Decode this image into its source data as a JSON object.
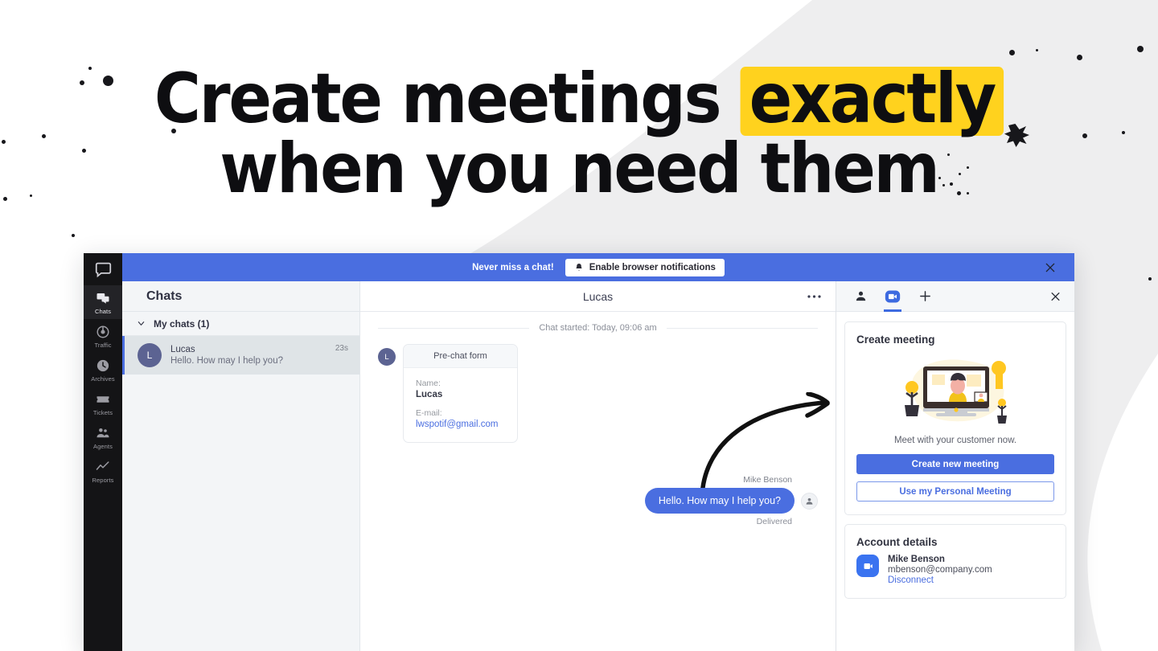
{
  "hero": {
    "line1_pre": "Create meetings ",
    "line1_mark": "exactly",
    "line2": "when you need them",
    "highlight_color": "#ffd21e"
  },
  "app": {
    "rail": {
      "logo_icon": "livechat-logo-icon",
      "items": [
        {
          "label": "Chats",
          "icon": "chats-icon",
          "active": true
        },
        {
          "label": "Traffic",
          "icon": "traffic-icon",
          "active": false
        },
        {
          "label": "Archives",
          "icon": "archives-icon",
          "active": false
        },
        {
          "label": "Tickets",
          "icon": "tickets-icon",
          "active": false
        },
        {
          "label": "Agents",
          "icon": "agents-icon",
          "active": false
        },
        {
          "label": "Reports",
          "icon": "reports-icon",
          "active": false
        }
      ]
    },
    "banner": {
      "text": "Never miss a chat!",
      "button_label": "Enable browser notifications",
      "button_icon": "bell-icon",
      "close_icon": "close-icon",
      "background": "#4a6ee0"
    },
    "chat_list": {
      "title": "Chats",
      "group_label": "My chats (1)",
      "group_chevron": "chevron-down-icon",
      "items": [
        {
          "avatar_initial": "L",
          "name": "Lucas",
          "snippet": "Hello. How may I help you?",
          "time": "23s"
        }
      ]
    },
    "conversation": {
      "title": "Lucas",
      "menu_icon": "more-options-icon",
      "started_label": "Chat started: Today, 09:06 am",
      "incoming_avatar_initial": "L",
      "prechat": {
        "header": "Pre-chat form",
        "name_label": "Name:",
        "name_value": "Lucas",
        "email_label": "E-mail:",
        "email_value": "lwspotif@gmail.com"
      },
      "outgoing": {
        "author": "Mike Benson",
        "text": "Hello. How may I help you?",
        "status": "Delivered",
        "avatar_icon": "agent-avatar-icon",
        "bubble_color": "#4a6ee0"
      }
    },
    "panel": {
      "tabs": [
        {
          "icon": "person-icon",
          "active": false
        },
        {
          "icon": "zoom-video-icon",
          "active": true
        },
        {
          "icon": "plus-icon",
          "active": false
        }
      ],
      "close_icon": "close-icon",
      "create_meeting": {
        "title": "Create meeting",
        "illustration": "video-call-illustration",
        "subtitle": "Meet with your customer now.",
        "primary_button": "Create new meeting",
        "secondary_button": "Use my Personal Meeting"
      },
      "account_details": {
        "title": "Account details",
        "provider_icon": "zoom-icon",
        "name": "Mike Benson",
        "email": "mbenson@company.com",
        "disconnect_label": "Disconnect"
      }
    }
  }
}
